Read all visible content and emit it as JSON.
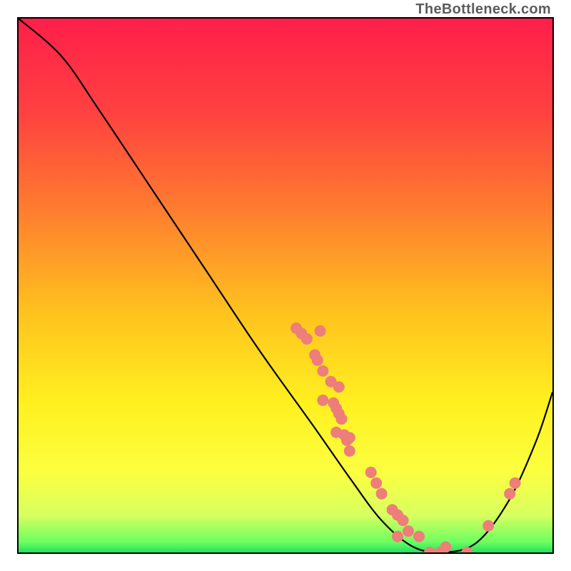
{
  "watermark": "TheBottleneck.com",
  "chart_data": {
    "type": "line",
    "title": "",
    "xlabel": "",
    "ylabel": "",
    "xlim": [
      0,
      100
    ],
    "ylim": [
      0,
      100
    ],
    "grid": false,
    "legend": false,
    "curve_points": [
      {
        "x": 0,
        "y": 100
      },
      {
        "x": 8,
        "y": 93
      },
      {
        "x": 15,
        "y": 83
      },
      {
        "x": 25,
        "y": 68
      },
      {
        "x": 35,
        "y": 53
      },
      {
        "x": 45,
        "y": 38
      },
      {
        "x": 55,
        "y": 24
      },
      {
        "x": 62,
        "y": 14
      },
      {
        "x": 68,
        "y": 6
      },
      {
        "x": 74,
        "y": 1
      },
      {
        "x": 80,
        "y": 0
      },
      {
        "x": 86,
        "y": 2
      },
      {
        "x": 92,
        "y": 10
      },
      {
        "x": 97,
        "y": 21
      },
      {
        "x": 100,
        "y": 30
      }
    ],
    "markers": [
      {
        "x": 52,
        "y": 42
      },
      {
        "x": 53,
        "y": 41
      },
      {
        "x": 56.5,
        "y": 41.5
      },
      {
        "x": 54,
        "y": 40
      },
      {
        "x": 55.5,
        "y": 37
      },
      {
        "x": 56,
        "y": 36
      },
      {
        "x": 57,
        "y": 34
      },
      {
        "x": 58.5,
        "y": 32
      },
      {
        "x": 60,
        "y": 31
      },
      {
        "x": 57,
        "y": 28.5
      },
      {
        "x": 59,
        "y": 28
      },
      {
        "x": 59.5,
        "y": 27
      },
      {
        "x": 60,
        "y": 26
      },
      {
        "x": 60.5,
        "y": 25
      },
      {
        "x": 59.5,
        "y": 22.5
      },
      {
        "x": 61,
        "y": 22
      },
      {
        "x": 61.5,
        "y": 21
      },
      {
        "x": 62,
        "y": 21.5
      },
      {
        "x": 62,
        "y": 19
      },
      {
        "x": 66,
        "y": 15
      },
      {
        "x": 67,
        "y": 13
      },
      {
        "x": 68,
        "y": 11
      },
      {
        "x": 70,
        "y": 8
      },
      {
        "x": 71,
        "y": 7
      },
      {
        "x": 72,
        "y": 6
      },
      {
        "x": 71,
        "y": 3
      },
      {
        "x": 73,
        "y": 4
      },
      {
        "x": 75,
        "y": 3
      },
      {
        "x": 77,
        "y": 0
      },
      {
        "x": 79,
        "y": 0
      },
      {
        "x": 80,
        "y": 1
      },
      {
        "x": 84,
        "y": 0
      },
      {
        "x": 88,
        "y": 5
      },
      {
        "x": 92,
        "y": 11
      },
      {
        "x": 93,
        "y": 13
      }
    ],
    "gradient_stops": [
      {
        "offset": 0.0,
        "color": "#ff1f4a"
      },
      {
        "offset": 0.18,
        "color": "#ff4240"
      },
      {
        "offset": 0.35,
        "color": "#ff7a30"
      },
      {
        "offset": 0.55,
        "color": "#ffc21e"
      },
      {
        "offset": 0.72,
        "color": "#fff020"
      },
      {
        "offset": 0.85,
        "color": "#fbff40"
      },
      {
        "offset": 0.93,
        "color": "#d8ff60"
      },
      {
        "offset": 0.98,
        "color": "#6eff60"
      },
      {
        "offset": 1.0,
        "color": "#22e060"
      }
    ]
  }
}
